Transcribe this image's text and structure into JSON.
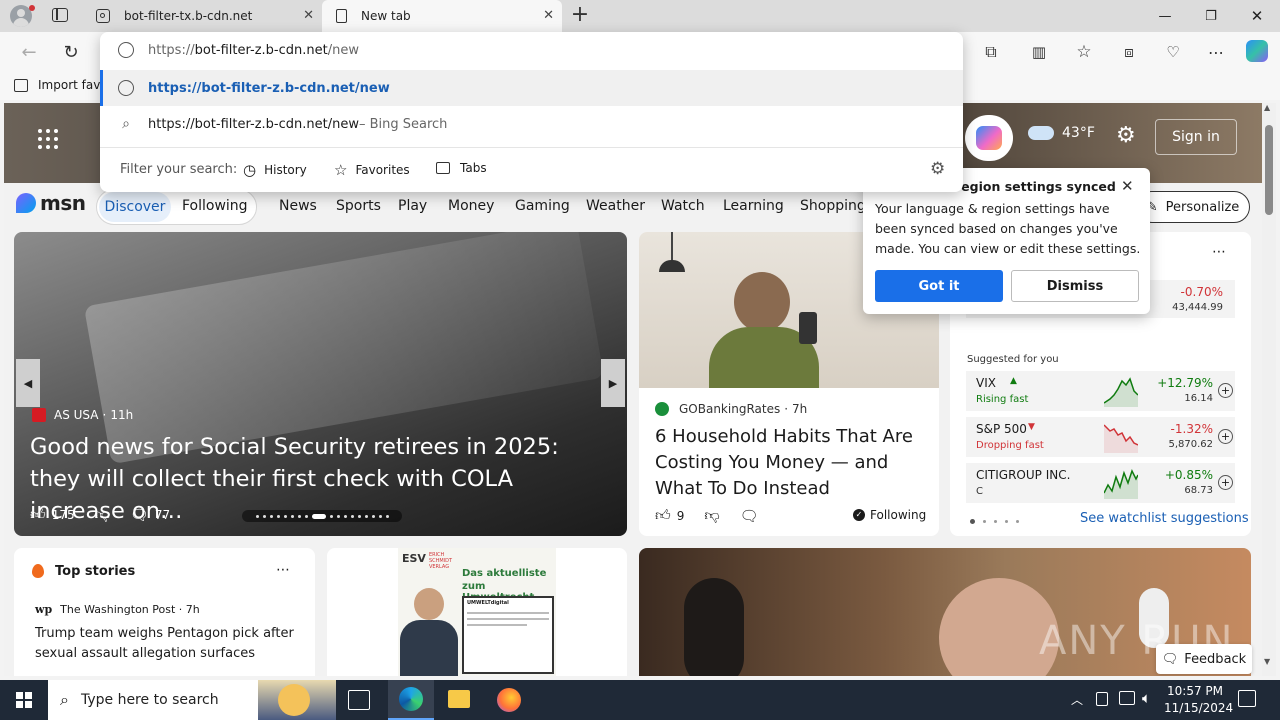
{
  "browser": {
    "tabs": [
      {
        "title": "bot-filter-tx.b-cdn.net"
      },
      {
        "title": "New tab"
      }
    ],
    "new_tab_symbol": "+",
    "favorites_bar": {
      "import_label": "Import favo"
    }
  },
  "omnibox": {
    "input_value": "https://bot-filter-z.b-cdn.net/new",
    "input_prefix": "https://",
    "input_domain": "bot-filter-z.b-cdn.net",
    "input_path": "/new",
    "suggestion_url": "https://bot-filter-z.b-cdn.net/new",
    "search_text": "https://bot-filter-z.b-cdn.net/new",
    "search_suffix": " – Bing Search",
    "filter_label": "Filter your search:",
    "filters": [
      "History",
      "Favorites",
      "Tabs"
    ]
  },
  "msn": {
    "logo": "msn",
    "weather": "43°F",
    "sign_in": "Sign in",
    "nav": [
      "Discover",
      "Following",
      "News",
      "Sports",
      "Play",
      "Money",
      "Gaming",
      "Weather",
      "Watch",
      "Learning",
      "Shopping"
    ],
    "personalize": "Personalize",
    "hero": {
      "source": "AS USA",
      "age": "11h",
      "headline": "Good news for Social Security retirees in 2025: they will collect their first check with COLA increase on…",
      "likes": "175",
      "comments": "77"
    },
    "story2": {
      "source": "GOBankingRates",
      "age": "7h",
      "headline": "6 Household Habits That Are Costing You Money — and What To Do Instead",
      "likes": "9",
      "following": "Following"
    },
    "popup": {
      "title": "region settings synced",
      "body": "Your language & region settings have been synced based on changes you've made. You can view or edit these settings.",
      "got_it": "Got it",
      "dismiss": "Dismiss"
    },
    "watchlist": {
      "top": {
        "change": "-0.70%",
        "value": "43,444.99"
      },
      "suggested_label": "Suggested for you",
      "items": [
        {
          "name": "VIX",
          "note": "Rising fast",
          "change": "+12.79%",
          "value": "16.14",
          "color": "#107c10"
        },
        {
          "name": "S&P 500",
          "note": "Dropping fast",
          "change": "-1.32%",
          "value": "5,870.62",
          "color": "#d13438"
        },
        {
          "name": "CITIGROUP INC.",
          "note": "C",
          "change": "+0.85%",
          "value": "68.73",
          "color": "#107c10"
        }
      ],
      "see_more": "See watchlist suggestions"
    },
    "top_stories": {
      "title": "Top stories",
      "source": "The Washington Post · 7h",
      "headline": "Trump team weighs Pentagon pick after sexual assault allegation surfaces"
    },
    "ad": {
      "line1": "Das aktuelliste",
      "line2": "zum Umweltrecht",
      "brand": "ESV",
      "brand_sub": "ERICH SCHMIDT VERLAG",
      "badge": "UMWELTdigital"
    },
    "feedback": "Feedback",
    "watermark": "ANY RUN"
  },
  "taskbar": {
    "search_placeholder": "Type here to search",
    "time": "10:57 PM",
    "date": "11/15/2024"
  },
  "colors": {
    "accent": "#1a6fe8",
    "discover_bg": "#e6effa",
    "up": "#107c10",
    "down": "#d13438"
  }
}
